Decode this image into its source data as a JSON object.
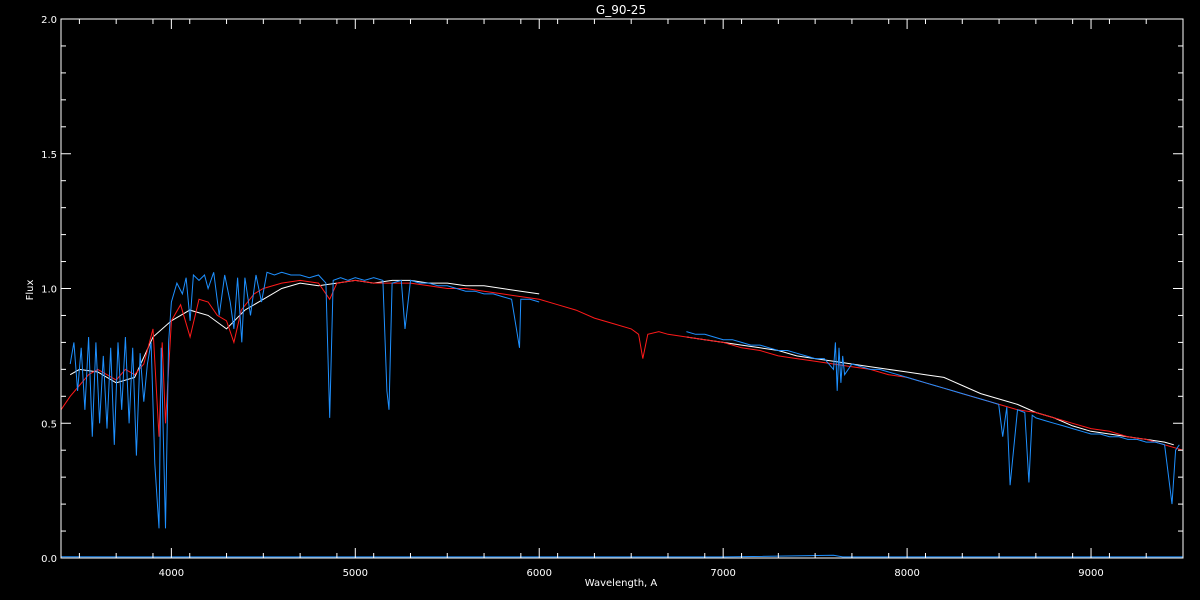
{
  "chart_data": {
    "type": "line",
    "title": "G_90-25",
    "xlabel": "Wavelength, A",
    "ylabel": "Flux",
    "xlim": [
      3400,
      9500
    ],
    "ylim": [
      0.0,
      2.0
    ],
    "x_ticks": [
      4000,
      5000,
      6000,
      7000,
      8000,
      9000
    ],
    "x_tick_labels": [
      "4000",
      "5000",
      "6000",
      "7000",
      "8000",
      "9000"
    ],
    "y_ticks": [
      0.0,
      0.5,
      1.0,
      1.5,
      2.0
    ],
    "y_tick_labels": [
      "0.0",
      "0.5",
      "1.0",
      "1.5",
      "2.0"
    ],
    "background": "#000000",
    "axis_color": "#ffffff",
    "series": [
      {
        "color": "#ffffff",
        "segments": [
          {
            "x": [
              3450,
              3500,
              3600,
              3700,
              3800,
              3900,
              4000,
              4100,
              4200,
              4300,
              4400,
              4500,
              4600,
              4700,
              4800,
              4900,
              5000,
              5100,
              5200,
              5300,
              5400,
              5500,
              5600,
              5700,
              5800,
              5900,
              6000
            ],
            "y": [
              0.68,
              0.7,
              0.69,
              0.65,
              0.67,
              0.82,
              0.88,
              0.92,
              0.9,
              0.85,
              0.92,
              0.96,
              1.0,
              1.02,
              1.01,
              1.02,
              1.03,
              1.02,
              1.03,
              1.03,
              1.02,
              1.02,
              1.01,
              1.01,
              1.0,
              0.99,
              0.98
            ]
          },
          {
            "x": [
              6800,
              6900,
              7000,
              7100,
              7200,
              7300,
              7400,
              7500,
              7600,
              7700,
              7800,
              7900,
              8000,
              8100,
              8200,
              8300,
              8400,
              8500,
              8600,
              8700,
              8800,
              8900,
              9000,
              9100,
              9200,
              9300,
              9400,
              9450
            ],
            "y": [
              0.82,
              0.81,
              0.8,
              0.79,
              0.78,
              0.77,
              0.75,
              0.74,
              0.73,
              0.72,
              0.71,
              0.7,
              0.69,
              0.68,
              0.67,
              0.64,
              0.61,
              0.59,
              0.57,
              0.54,
              0.52,
              0.49,
              0.47,
              0.46,
              0.45,
              0.44,
              0.43,
              0.42
            ]
          }
        ]
      },
      {
        "color": "#ff1a1a",
        "segments": [
          {
            "x": [
              3400,
              3450,
              3500,
              3550,
              3600,
              3650,
              3700,
              3750,
              3800,
              3850,
              3900,
              3933,
              3950,
              3968,
              4000,
              4050,
              4102,
              4150,
              4200,
              4250,
              4300,
              4340,
              4380,
              4450,
              4500,
              4600,
              4700,
              4800,
              4861,
              4900,
              5000,
              5100,
              5200,
              5300,
              5400,
              5500,
              5600,
              5700,
              5800,
              5900,
              6000,
              6100,
              6200,
              6300,
              6400,
              6500,
              6540,
              6563,
              6590,
              6650,
              6700,
              6800,
              6900,
              7000,
              7100,
              7200,
              7300,
              7400,
              7500,
              7600,
              7700,
              7800,
              7900,
              8000,
              8100,
              8200,
              8300,
              8400,
              8500,
              8600,
              8700,
              8800,
              8900,
              9000,
              9100,
              9200,
              9300,
              9400,
              9500
            ],
            "y": [
              0.55,
              0.6,
              0.64,
              0.68,
              0.7,
              0.68,
              0.66,
              0.7,
              0.68,
              0.72,
              0.85,
              0.45,
              0.8,
              0.5,
              0.88,
              0.94,
              0.82,
              0.96,
              0.95,
              0.9,
              0.88,
              0.8,
              0.92,
              0.98,
              1.0,
              1.02,
              1.03,
              1.02,
              0.96,
              1.02,
              1.03,
              1.02,
              1.02,
              1.02,
              1.01,
              1.0,
              1.0,
              0.99,
              0.98,
              0.97,
              0.96,
              0.94,
              0.92,
              0.89,
              0.87,
              0.85,
              0.83,
              0.74,
              0.83,
              0.84,
              0.83,
              0.82,
              0.81,
              0.8,
              0.78,
              0.77,
              0.75,
              0.74,
              0.73,
              0.72,
              0.71,
              0.7,
              0.68,
              0.67,
              0.65,
              0.63,
              0.61,
              0.59,
              0.57,
              0.55,
              0.54,
              0.52,
              0.5,
              0.48,
              0.47,
              0.45,
              0.44,
              0.42,
              0.4
            ]
          }
        ]
      },
      {
        "color": "#1e90ff",
        "segments": [
          {
            "x": [
              3450,
              3470,
              3490,
              3510,
              3530,
              3550,
              3570,
              3590,
              3610,
              3630,
              3650,
              3670,
              3690,
              3710,
              3730,
              3750,
              3770,
              3790,
              3810,
              3830,
              3850,
              3870,
              3890,
              3910,
              3933,
              3945,
              3968,
              3985,
              4000,
              4030,
              4060,
              4080,
              4102,
              4120,
              4150,
              4180,
              4200,
              4230,
              4260,
              4290,
              4320,
              4340,
              4360,
              4383,
              4400,
              4430,
              4460,
              4490,
              4520,
              4560,
              4600,
              4650,
              4700,
              4750,
              4800,
              4840,
              4861,
              4880,
              4920,
              4960,
              5000,
              5050,
              5100,
              5150,
              5172,
              5183,
              5200,
              5250,
              5270,
              5300,
              5350,
              5400,
              5450,
              5500,
              5550,
              5600,
              5650,
              5700,
              5750,
              5800,
              5850,
              5893,
              5900,
              5950,
              6000
            ],
            "y": [
              0.72,
              0.8,
              0.62,
              0.78,
              0.55,
              0.82,
              0.45,
              0.8,
              0.5,
              0.75,
              0.48,
              0.78,
              0.42,
              0.8,
              0.55,
              0.82,
              0.5,
              0.78,
              0.38,
              0.76,
              0.58,
              0.72,
              0.8,
              0.35,
              0.11,
              0.78,
              0.11,
              0.8,
              0.95,
              1.02,
              0.98,
              1.04,
              0.88,
              1.05,
              1.03,
              1.05,
              1.0,
              1.06,
              0.9,
              1.05,
              0.95,
              0.85,
              1.04,
              0.8,
              1.04,
              0.9,
              1.05,
              0.95,
              1.06,
              1.05,
              1.06,
              1.05,
              1.05,
              1.04,
              1.05,
              1.02,
              0.52,
              1.03,
              1.04,
              1.03,
              1.04,
              1.03,
              1.04,
              1.03,
              0.62,
              0.55,
              1.02,
              1.03,
              0.85,
              1.03,
              1.02,
              1.02,
              1.01,
              1.01,
              1.0,
              0.99,
              0.99,
              0.98,
              0.98,
              0.97,
              0.96,
              0.78,
              0.96,
              0.96,
              0.95
            ]
          },
          {
            "x": [
              6800,
              6850,
              6900,
              6950,
              7000,
              7050,
              7100,
              7150,
              7200,
              7250,
              7300,
              7350,
              7400,
              7450,
              7500,
              7550,
              7600,
              7610,
              7620,
              7630,
              7640,
              7650,
              7660,
              7700,
              7750,
              7800,
              7850,
              7900,
              7950,
              8000,
              8050,
              8100,
              8150,
              8200,
              8250,
              8300,
              8350,
              8400,
              8450,
              8498,
              8520,
              8542,
              8560,
              8600,
              8640,
              8662,
              8680,
              8700,
              8750,
              8800,
              8850,
              8900,
              8950,
              9000,
              9050,
              9100,
              9150,
              9200,
              9250,
              9300,
              9350,
              9400,
              9440,
              9460,
              9480
            ],
            "y": [
              0.84,
              0.83,
              0.83,
              0.82,
              0.81,
              0.81,
              0.8,
              0.79,
              0.79,
              0.78,
              0.77,
              0.77,
              0.76,
              0.75,
              0.74,
              0.74,
              0.7,
              0.8,
              0.62,
              0.78,
              0.65,
              0.75,
              0.68,
              0.72,
              0.71,
              0.7,
              0.7,
              0.69,
              0.68,
              0.67,
              0.66,
              0.65,
              0.64,
              0.63,
              0.62,
              0.61,
              0.6,
              0.59,
              0.58,
              0.57,
              0.45,
              0.56,
              0.27,
              0.55,
              0.54,
              0.28,
              0.53,
              0.52,
              0.51,
              0.5,
              0.49,
              0.48,
              0.47,
              0.46,
              0.46,
              0.45,
              0.45,
              0.44,
              0.44,
              0.43,
              0.43,
              0.42,
              0.2,
              0.4,
              0.42
            ]
          },
          {
            "x": [
              3400,
              4000,
              5000,
              6000,
              7000,
              7600,
              7650,
              8000,
              9000,
              9500
            ],
            "y": [
              0.005,
              0.004,
              0.004,
              0.004,
              0.004,
              0.01,
              0.004,
              0.004,
              0.004,
              0.004
            ]
          }
        ]
      }
    ]
  }
}
